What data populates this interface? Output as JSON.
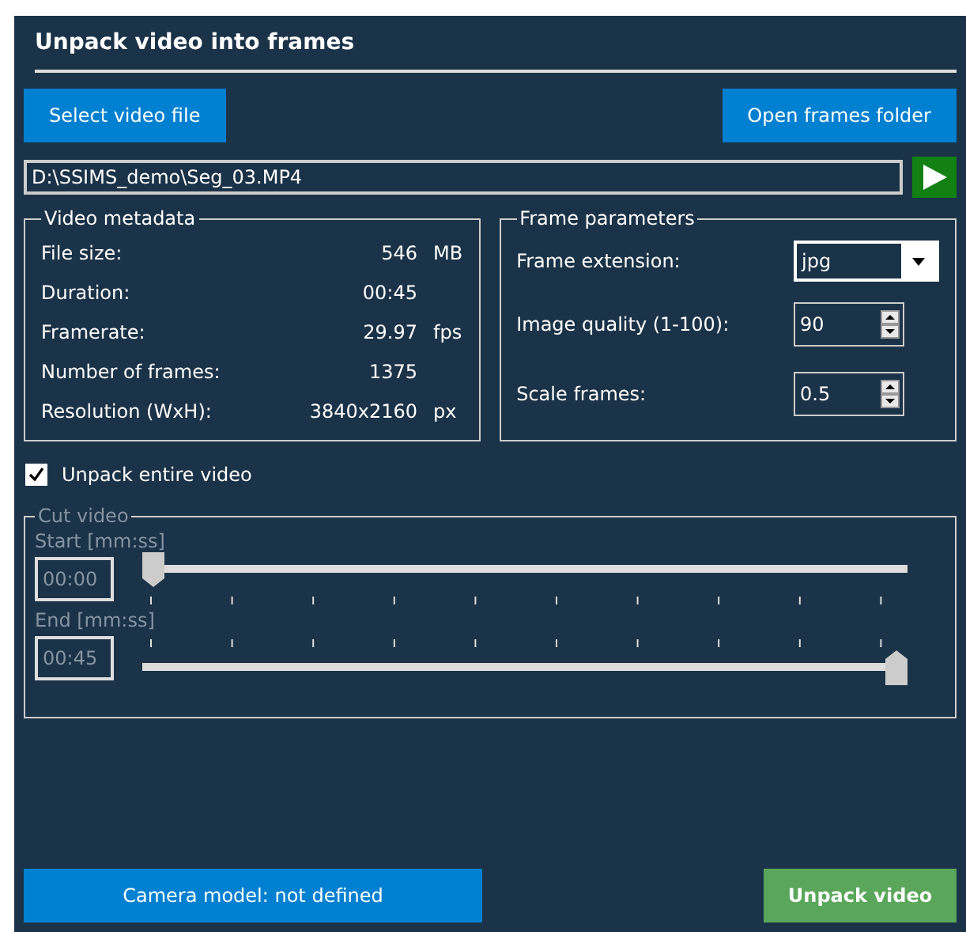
{
  "window": {
    "title": "Unpack video into frames"
  },
  "select_button": "Select video file",
  "open_folder_button": "Open frames folder",
  "file_path": "D:\\SSIMS_demo\\Seg_03.MP4",
  "metadata": {
    "title": "Video metadata",
    "rows": [
      {
        "label": "File size:",
        "value": "546",
        "unit": "MB"
      },
      {
        "label": "Duration:",
        "value": "00:45"
      },
      {
        "label": "Framerate:",
        "value": "29.97",
        "unit": "fps"
      },
      {
        "label": "Number of frames:",
        "value": "1375"
      },
      {
        "label": "Resolution (WxH):",
        "value": "3840x2160",
        "unit": "px"
      }
    ]
  },
  "frame_parameters": {
    "title": "Frame parameters",
    "rows": [
      {
        "kind": "dropdown",
        "label": "Frame extension:",
        "value": "jpg"
      },
      {
        "kind": "spinner",
        "label": "Image quality (1-100):",
        "value": "90"
      },
      {
        "kind": "spinner",
        "label": "Scale frames:",
        "value": "0.5"
      }
    ]
  },
  "unpack_entire": {
    "label": "Unpack entire video",
    "checked": true
  },
  "cut_video": {
    "title": "Cut video",
    "disabled": true,
    "sliders": [
      {
        "label": "Start [mm:ss]",
        "value": "00:00",
        "level": 0,
        "ticks_above": false
      },
      {
        "label": "End [mm:ss]",
        "value": "00:45",
        "level": 1,
        "ticks_above": true
      }
    ]
  },
  "camera_button": "Camera model: not defined",
  "unpack_button": "Unpack video"
}
